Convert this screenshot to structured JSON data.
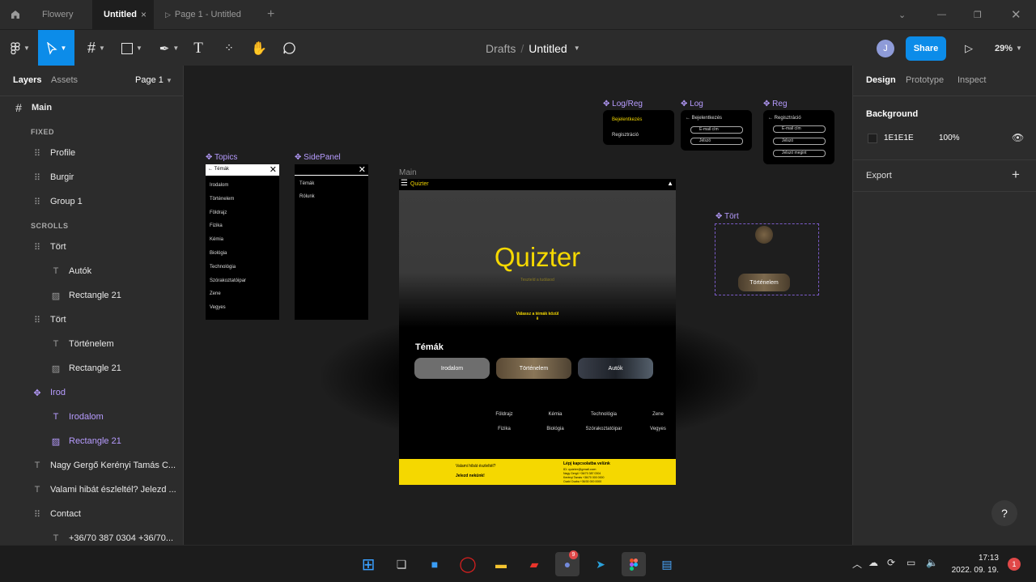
{
  "tabs": {
    "home_icon": "home-icon",
    "items": [
      {
        "label": "Flowery"
      },
      {
        "label": "Untitled"
      },
      {
        "label": "Page 1 - Untitled"
      }
    ],
    "new_tab": "+"
  },
  "toolbar": {
    "breadcrumb_parent": "Drafts",
    "breadcrumb_sep": "/",
    "file_name": "Untitled",
    "avatar": "J",
    "share_label": "Share",
    "zoom": "29%"
  },
  "left_panel": {
    "tab_layers": "Layers",
    "tab_assets": "Assets",
    "page_select": "Page 1",
    "layers": [
      {
        "label": "Main",
        "type": "frame",
        "indent": 0
      },
      {
        "label": "FIXED",
        "type": "section"
      },
      {
        "label": "Profile",
        "type": "group",
        "indent": 1
      },
      {
        "label": "Burgir",
        "type": "group",
        "indent": 1
      },
      {
        "label": "Group 1",
        "type": "group",
        "indent": 1
      },
      {
        "label": "SCROLLS",
        "type": "section"
      },
      {
        "label": "Tört",
        "type": "group",
        "indent": 1
      },
      {
        "label": "Autók",
        "type": "text",
        "indent": 2
      },
      {
        "label": "Rectangle 21",
        "type": "image",
        "indent": 2
      },
      {
        "label": "Tört",
        "type": "group",
        "indent": 1
      },
      {
        "label": "Történelem",
        "type": "text",
        "indent": 2
      },
      {
        "label": "Rectangle 21",
        "type": "image",
        "indent": 2
      },
      {
        "label": "Irod",
        "type": "component",
        "indent": 1
      },
      {
        "label": "Irodalom",
        "type": "text-comp",
        "indent": 2
      },
      {
        "label": "Rectangle 21",
        "type": "image-comp",
        "indent": 2
      },
      {
        "label": "Nagy Gergő Kerényi Tamás C...",
        "type": "text",
        "indent": 1
      },
      {
        "label": "Valami hibát észleltél? Jelezd ...",
        "type": "text",
        "indent": 1
      },
      {
        "label": "Contact",
        "type": "group",
        "indent": 1
      },
      {
        "label": "+36/70 387 0304 +36/70...",
        "type": "text",
        "indent": 2
      }
    ]
  },
  "right_panel": {
    "tab_design": "Design",
    "tab_prototype": "Prototype",
    "tab_inspect": "Inspect",
    "background_title": "Background",
    "bg_hex": "1E1E1E",
    "bg_opacity": "100%",
    "export_title": "Export",
    "export_add": "+",
    "help": "?"
  },
  "canvas": {
    "frames": {
      "logreg": "Log/Reg",
      "log": "Log",
      "reg": "Reg",
      "topics": "Topics",
      "sidepanel": "SidePanel",
      "main": "Main",
      "tort": "Tört"
    },
    "logreg_items": [
      "Bejelentkezés",
      "Regisztráció"
    ],
    "log_title": "Bejelentkezés",
    "log_fields": [
      "E-mail cím",
      "Jelszó"
    ],
    "reg_title": "Regisztráció",
    "reg_fields": [
      "E-mail cím",
      "Jelszó",
      "Jelszó megint"
    ],
    "topics_header": "Témák",
    "topics_items": [
      "Irodalom",
      "Történelem",
      "Földrajz",
      "Fizika",
      "Kémia",
      "Biológia",
      "Technológia",
      "Szórakoztatóipar",
      "Zene",
      "Vegyes"
    ],
    "sidepanel_items": [
      "Témák",
      "Rólunk"
    ],
    "main": {
      "brand": "Quizter",
      "hero_title": "Quizter",
      "hero_subtitle": "Teszteld a tudásod",
      "cta": "Válassz a témák közül",
      "section_title": "Témák",
      "cards": [
        "Irodalom",
        "Történelem",
        "Autók"
      ],
      "grid": [
        "Földrajz",
        "Kémia",
        "Technológia",
        "Zene",
        "Fizika",
        "Biológia",
        "Szórakoztatóipar",
        "Vegyes"
      ],
      "footer_left1": "Valami hibát észleltél?",
      "footer_left2": "Jelezd nekünk!",
      "footer_contact_title": "Lépj kapcsolatba velünk",
      "footer_email": "ID: quizter@gmail.com",
      "footer_contacts": [
        "Nagy Gergő   +36/70 387 0304",
        "Kerényi Tamás   +36/70 000 0000",
        "Csaki Csaba   +36/30 000 0000"
      ]
    },
    "tort_card": "Történelem"
  },
  "taskbar": {
    "time": "17:13",
    "date": "2022. 09. 19.",
    "notif_count": "1",
    "discord_badge": "9"
  }
}
